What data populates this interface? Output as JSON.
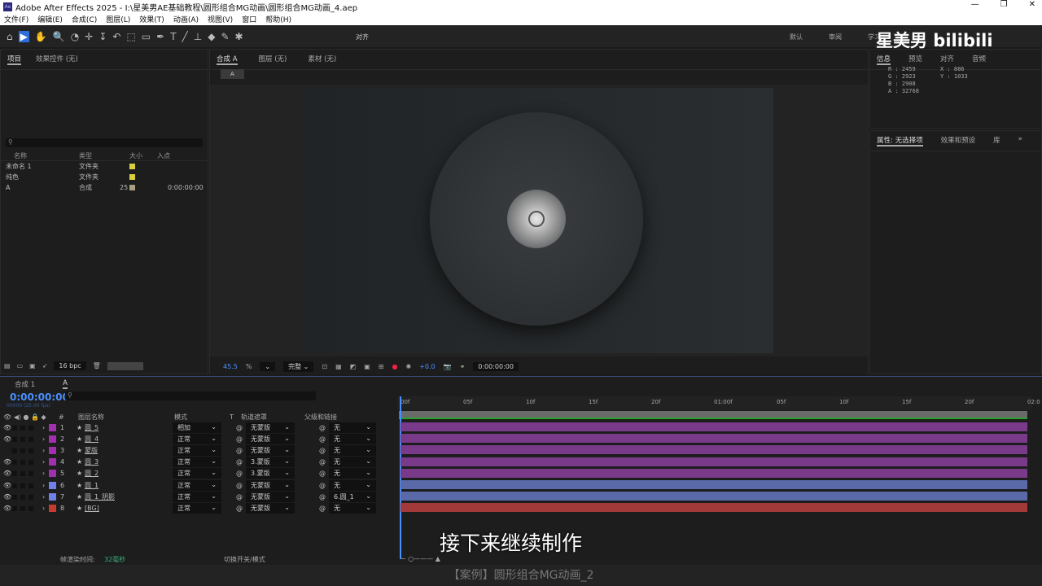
{
  "title": "Adobe After Effects 2025 - I:\\星美男AE基础教程\\圆形组合MG动画\\圆形组合MG动画_4.aep",
  "window_controls": [
    "—",
    "❐",
    "✕"
  ],
  "menu": [
    "文件(F)",
    "编辑(E)",
    "合成(C)",
    "图层(L)",
    "效果(T)",
    "动画(A)",
    "视图(V)",
    "窗口",
    "帮助(H)"
  ],
  "toolbar": {
    "tools": [
      "⌂",
      "▶",
      "✋",
      "🔍",
      "◔",
      "✛",
      "↧",
      "↶",
      "⬚",
      "▭",
      "✒",
      "T",
      "╱",
      "⊥",
      "◆",
      "✎",
      "✱"
    ],
    "align_label": "对齐",
    "workspaces": [
      "默认",
      "审阅",
      "学习"
    ],
    "more": "»"
  },
  "watermark": "星美男 bilibili",
  "project": {
    "tabs": [
      "项目",
      "效果控件 (无)"
    ],
    "columns": [
      "名称",
      "类型",
      "大小",
      "入点"
    ],
    "items": [
      {
        "name": "未命名 1",
        "type": "文件夹",
        "size": "",
        "in": "",
        "color": "#d8d040"
      },
      {
        "name": "纯色",
        "type": "文件夹",
        "size": "",
        "in": "",
        "color": "#d8d040"
      },
      {
        "name": "A",
        "type": "合成",
        "size": "25",
        "in": "0:00:00:00",
        "color": "#a8a080"
      }
    ],
    "bpc": "16 bpc"
  },
  "comp": {
    "tabs": [
      "合成 A",
      "图层 (无)",
      "素材 (无)"
    ],
    "breadcrumb": "A",
    "zoom": "45.5",
    "zoom_unit": "%",
    "quality": "完整",
    "exposure": "+0.0",
    "timecode": "0:00:00:00"
  },
  "info": {
    "tabs": [
      "信息",
      "预览",
      "对齐",
      "音频"
    ],
    "R": "R : 2459",
    "G": "G : 2923",
    "B": "B : 2908",
    "A": "A : 32768",
    "X": "X : 886",
    "Y": "Y : 1033"
  },
  "properties": {
    "tabs": [
      "属性: 无选择项",
      "效果和预设",
      "库"
    ],
    "more": "»"
  },
  "timeline": {
    "tabs": [
      "合成 1",
      "A"
    ],
    "timecode": "0:00:00:00",
    "fps": "00000 (25.00 fps)",
    "columns": [
      "#",
      "图层名称",
      "模式",
      "T",
      "轨道遮罩",
      "父级和链接"
    ],
    "ruler": [
      "00f",
      "05f",
      "10f",
      "15f",
      "20f",
      "01:00f",
      "05f",
      "10f",
      "15f",
      "20f",
      "02:0"
    ],
    "layers": [
      {
        "n": "1",
        "name": "圆_5",
        "mode": "相加",
        "matte": "无蒙版",
        "parent": "无",
        "color": "#a030b0",
        "bar": "#7a3a8a",
        "eye": true
      },
      {
        "n": "2",
        "name": "圆_4",
        "mode": "正常",
        "matte": "无蒙版",
        "parent": "无",
        "color": "#a030b0",
        "bar": "#7a3a8a",
        "eye": true
      },
      {
        "n": "3",
        "name": "蒙版",
        "mode": "正常",
        "matte": "无蒙版",
        "parent": "无",
        "color": "#a030b0",
        "bar": "#7a3a8a",
        "eye": false
      },
      {
        "n": "4",
        "name": "圆_3",
        "mode": "正常",
        "matte": "3.蒙版",
        "parent": "无",
        "color": "#a030b0",
        "bar": "#7a3a8a",
        "eye": true
      },
      {
        "n": "5",
        "name": "圆_2",
        "mode": "正常",
        "matte": "3.蒙版",
        "parent": "无",
        "color": "#a030b0",
        "bar": "#7a3a8a",
        "eye": true
      },
      {
        "n": "6",
        "name": "圆_1",
        "mode": "正常",
        "matte": "无蒙版",
        "parent": "无",
        "color": "#7080e8",
        "bar": "#5a6aa8",
        "eye": true
      },
      {
        "n": "7",
        "name": "圆_1_阴影",
        "mode": "正常",
        "matte": "无蒙版",
        "parent": "6.圆_1",
        "color": "#7080e8",
        "bar": "#5a6aa8",
        "eye": true
      },
      {
        "n": "8",
        "name": "[BG]",
        "mode": "正常",
        "matte": "无蒙版",
        "parent": "无",
        "color": "#c83a30",
        "bar": "#a33a3a",
        "eye": true
      }
    ],
    "render_label": "帧渲染时间:",
    "render_time": "32毫秒",
    "toggle_label": "切换开关/模式"
  },
  "subtitle": "接下来继续制作",
  "footer": "【案例】圆形组合MG动画_2"
}
